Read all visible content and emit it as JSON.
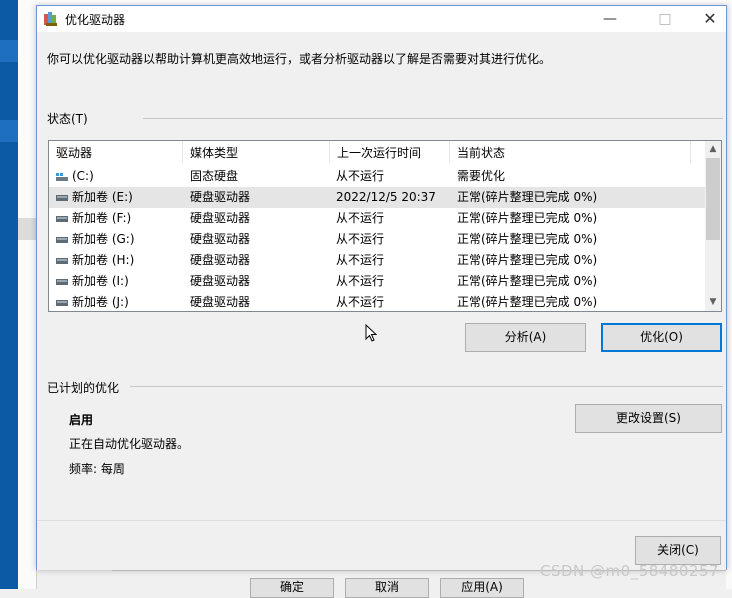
{
  "window": {
    "title": "优化驱动器",
    "minimize_icon": "minimize-icon",
    "maximize_icon": "maximize-icon",
    "close_icon": "close-icon"
  },
  "description": "你可以优化驱动器以帮助计算机更高效地运行，或者分析驱动器以了解是否需要对其进行优化。",
  "status_section": {
    "label": "状态(T)",
    "columns": [
      "驱动器",
      "媒体类型",
      "上一次运行时间",
      "当前状态"
    ],
    "rows": [
      {
        "icon": "ssd-drive-icon",
        "name": "(C:)",
        "media": "固态硬盘",
        "last_run": "从不运行",
        "status": "需要优化",
        "selected": false
      },
      {
        "icon": "hdd-drive-icon",
        "name": "新加卷 (E:)",
        "media": "硬盘驱动器",
        "last_run": "2022/12/5 20:37",
        "status": "正常(碎片整理已完成 0%)",
        "selected": true
      },
      {
        "icon": "hdd-drive-icon",
        "name": "新加卷 (F:)",
        "media": "硬盘驱动器",
        "last_run": "从不运行",
        "status": "正常(碎片整理已完成 0%)",
        "selected": false
      },
      {
        "icon": "hdd-drive-icon",
        "name": "新加卷 (G:)",
        "media": "硬盘驱动器",
        "last_run": "从不运行",
        "status": "正常(碎片整理已完成 0%)",
        "selected": false
      },
      {
        "icon": "hdd-drive-icon",
        "name": "新加卷 (H:)",
        "media": "硬盘驱动器",
        "last_run": "从不运行",
        "status": "正常(碎片整理已完成 0%)",
        "selected": false
      },
      {
        "icon": "hdd-drive-icon",
        "name": "新加卷 (I:)",
        "media": "硬盘驱动器",
        "last_run": "从不运行",
        "status": "正常(碎片整理已完成 0%)",
        "selected": false
      },
      {
        "icon": "hdd-drive-icon",
        "name": "新加卷 (J:)",
        "media": "硬盘驱动器",
        "last_run": "从不运行",
        "status": "正常(碎片整理已完成 0%)",
        "selected": false
      }
    ],
    "analyze_button": "分析(A)",
    "optimize_button": "优化(O)"
  },
  "scheduled_section": {
    "label": "已计划的优化",
    "state": "启用",
    "description": "正在自动优化驱动器。",
    "frequency": "频率: 每周",
    "change_settings_button": "更改设置(S)"
  },
  "footer": {
    "close_button": "关闭(C)"
  },
  "background": {
    "buttons": [
      "确定",
      "取消",
      "应用(A)"
    ]
  },
  "watermark": "CSDN @m0_58480257",
  "colors": {
    "accent": "#0078d7",
    "selected_row": "#e5e5e5",
    "dialog_border": "#6d9ad6"
  }
}
